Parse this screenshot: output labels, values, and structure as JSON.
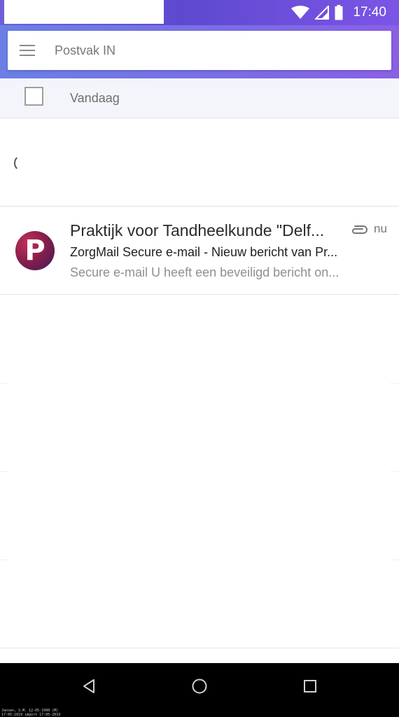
{
  "status_bar": {
    "time": "17:40",
    "icons": [
      "wifi-icon",
      "signal-icon",
      "battery-icon"
    ]
  },
  "header": {
    "title": "Postvak IN",
    "menu_icon": "hamburger-menu-icon"
  },
  "section": {
    "label": "Vandaag"
  },
  "mail_items": [
    {
      "avatar_letter": "P",
      "sender": "Praktijk voor Tandheelkunde \"Delf...",
      "subject": "ZorgMail Secure e-mail - Nieuw bericht van Pr...",
      "preview": "Secure e-mail U heeft een beveiligd bericht on...",
      "time": "nu",
      "has_attachment": true
    }
  ],
  "nav": {
    "back": "back-icon",
    "home": "home-icon",
    "recents": "recents-icon"
  },
  "colors": {
    "header_start": "#6b7fe6",
    "header_end": "#8a5fe6",
    "avatar": "#8a1f4a"
  },
  "overlay": {
    "line1": "Jansen, S.M. 12-05-1990 (M)",
    "line2": "17-05-2019 import 17-05-2019"
  }
}
